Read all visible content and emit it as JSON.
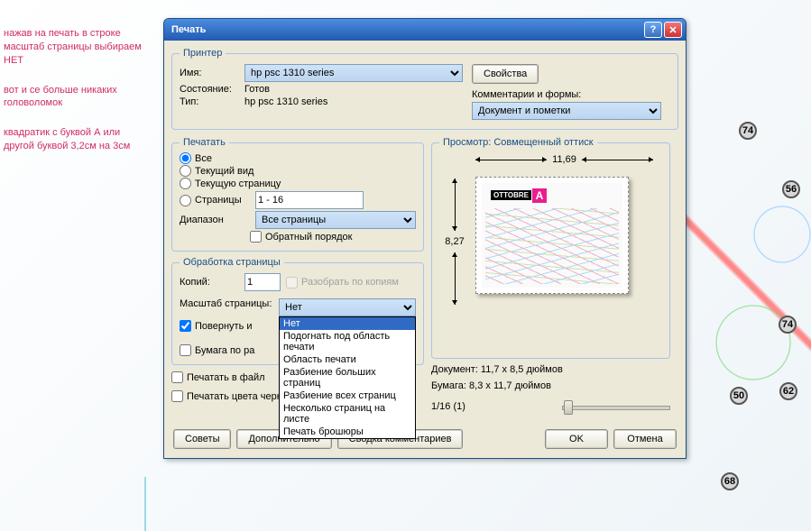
{
  "sideNote": {
    "p1": "нажав на печать в строке масштаб страницы выбираем НЕТ",
    "p2": "вот и се больше никаких головоломок",
    "p3": "квадратик с буквой А или другой буквой 3,2см на 3см"
  },
  "bgNumbers": {
    "n1": "74",
    "n2": "56",
    "n3": "74",
    "n4": "50",
    "n5": "62",
    "n6": "68"
  },
  "dialog": {
    "title": "Печать",
    "printer": {
      "legend": "Принтер",
      "nameLabel": "Имя:",
      "nameValue": "hp psc 1310 series",
      "propsBtn": "Свойства",
      "stateLabel": "Состояние:",
      "stateValue": "Готов",
      "typeLabel": "Тип:",
      "typeValue": "hp psc 1310 series",
      "commentsLabel": "Комментарии и формы:",
      "commentsValue": "Документ и пометки"
    },
    "printRange": {
      "legend": "Печатать",
      "all": "Все",
      "currentView": "Текущий вид",
      "currentPage": "Текущую страницу",
      "pages": "Страницы",
      "pagesValue": "1 - 16",
      "subrange": "Диапазон",
      "subrangeValue": "Все страницы",
      "reverse": "Обратный порядок"
    },
    "pageHandling": {
      "legend": "Обработка страницы",
      "copiesLabel": "Копий:",
      "copiesValue": "1",
      "collate": "Разобрать по копиям",
      "scaleLabel": "Масштаб страницы:",
      "scaleValue": "Нет",
      "scaleOptions": [
        "Нет",
        "Подогнать под область печати",
        "Область печати",
        "Разбиение больших страниц",
        "Разбиение всех страниц",
        "Несколько страниц на листе",
        "Печать брошюры"
      ],
      "rotate": "Повернуть и",
      "paperSource": "Бумага по ра"
    },
    "printToFile": "Печатать в файл",
    "printBlack": "Печатать цвета черным",
    "preview": {
      "legend": "Просмотр: Совмещенный оттиск",
      "width": "11,69",
      "height": "8,27",
      "brand": "OTTOBRE",
      "letter": "A",
      "docInfo": "Документ: 11,7 x 8,5 дюймов",
      "paperInfo": "Бумага: 8,3 x 11,7 дюймов",
      "pageCounter": "1/16 (1)"
    },
    "buttons": {
      "tips": "Советы",
      "advanced": "Дополнительно",
      "summary": "Сводка комментариев",
      "ok": "OK",
      "cancel": "Отмена"
    }
  }
}
